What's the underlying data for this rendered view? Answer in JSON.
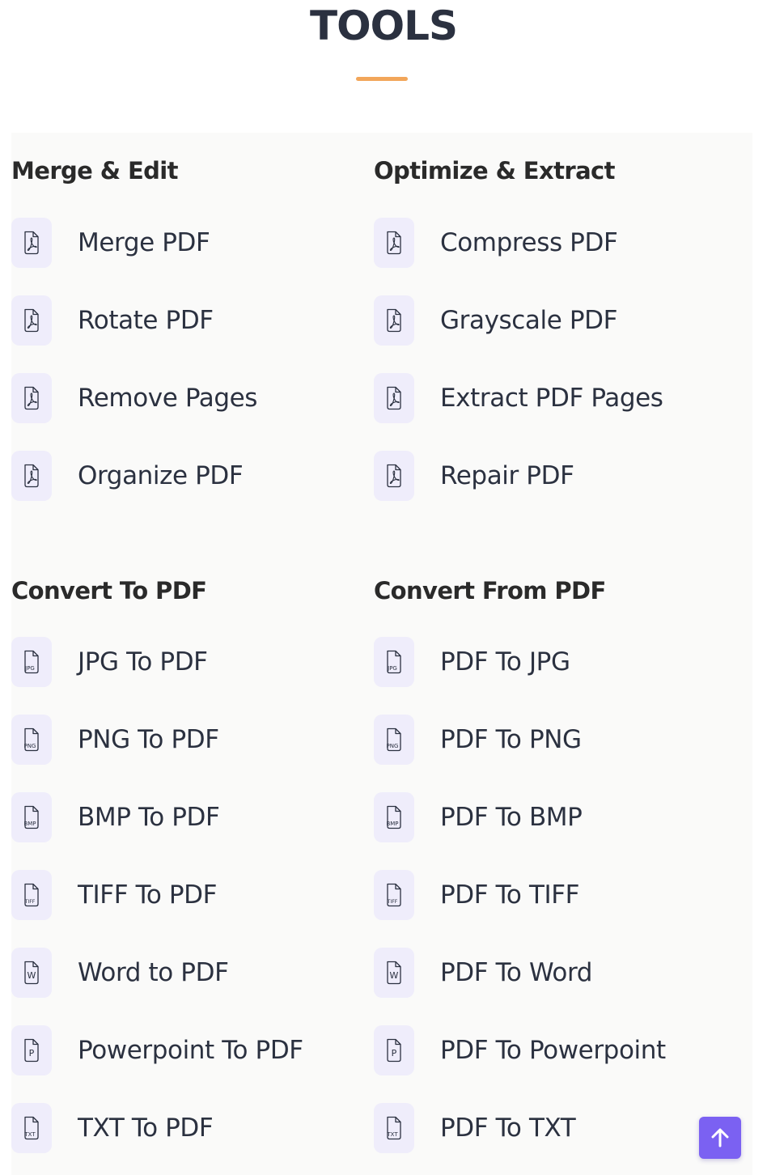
{
  "page": {
    "title": "TOOLS"
  },
  "colors": {
    "accent": "#f2a65a",
    "icon_bg": "#efedfb",
    "scroll_button": "#7b61f2",
    "text": "#2b3140"
  },
  "groups": {
    "merge_edit": {
      "heading": "Merge & Edit",
      "items": [
        {
          "label": "Merge PDF",
          "icon": "pdf-file-icon"
        },
        {
          "label": "Rotate PDF",
          "icon": "pdf-file-icon"
        },
        {
          "label": "Remove Pages",
          "icon": "pdf-file-icon"
        },
        {
          "label": "Organize PDF",
          "icon": "pdf-file-icon"
        }
      ]
    },
    "optimize_extract": {
      "heading": "Optimize & Extract",
      "items": [
        {
          "label": "Compress PDF",
          "icon": "pdf-file-icon"
        },
        {
          "label": "Grayscale PDF",
          "icon": "pdf-file-icon"
        },
        {
          "label": "Extract PDF Pages",
          "icon": "pdf-file-icon"
        },
        {
          "label": "Repair PDF",
          "icon": "pdf-file-icon"
        }
      ]
    },
    "convert_to": {
      "heading": "Convert To PDF",
      "items": [
        {
          "label": "JPG To PDF",
          "icon": "jpg-file-icon",
          "badge": "JPG"
        },
        {
          "label": "PNG To PDF",
          "icon": "png-file-icon",
          "badge": "PNG"
        },
        {
          "label": "BMP To PDF",
          "icon": "bmp-file-icon",
          "badge": "BMP"
        },
        {
          "label": "TIFF To PDF",
          "icon": "tiff-file-icon",
          "badge": "TIFF"
        },
        {
          "label": "Word to PDF",
          "icon": "word-file-icon",
          "badge": "W"
        },
        {
          "label": "Powerpoint To PDF",
          "icon": "powerpoint-file-icon",
          "badge": "P"
        },
        {
          "label": "TXT To PDF",
          "icon": "txt-file-icon",
          "badge": "TXT"
        }
      ]
    },
    "convert_from": {
      "heading": "Convert From PDF",
      "items": [
        {
          "label": "PDF To JPG",
          "icon": "jpg-file-icon",
          "badge": "JPG"
        },
        {
          "label": "PDF To PNG",
          "icon": "png-file-icon",
          "badge": "PNG"
        },
        {
          "label": "PDF To BMP",
          "icon": "bmp-file-icon",
          "badge": "BMP"
        },
        {
          "label": "PDF To TIFF",
          "icon": "tiff-file-icon",
          "badge": "TIFF"
        },
        {
          "label": "PDF To Word",
          "icon": "word-file-icon",
          "badge": "W"
        },
        {
          "label": "PDF To Powerpoint",
          "icon": "powerpoint-file-icon",
          "badge": "P"
        },
        {
          "label": "PDF To TXT",
          "icon": "txt-file-icon",
          "badge": "TXT"
        }
      ]
    }
  },
  "scroll_top": {
    "icon": "arrow-up-icon"
  }
}
